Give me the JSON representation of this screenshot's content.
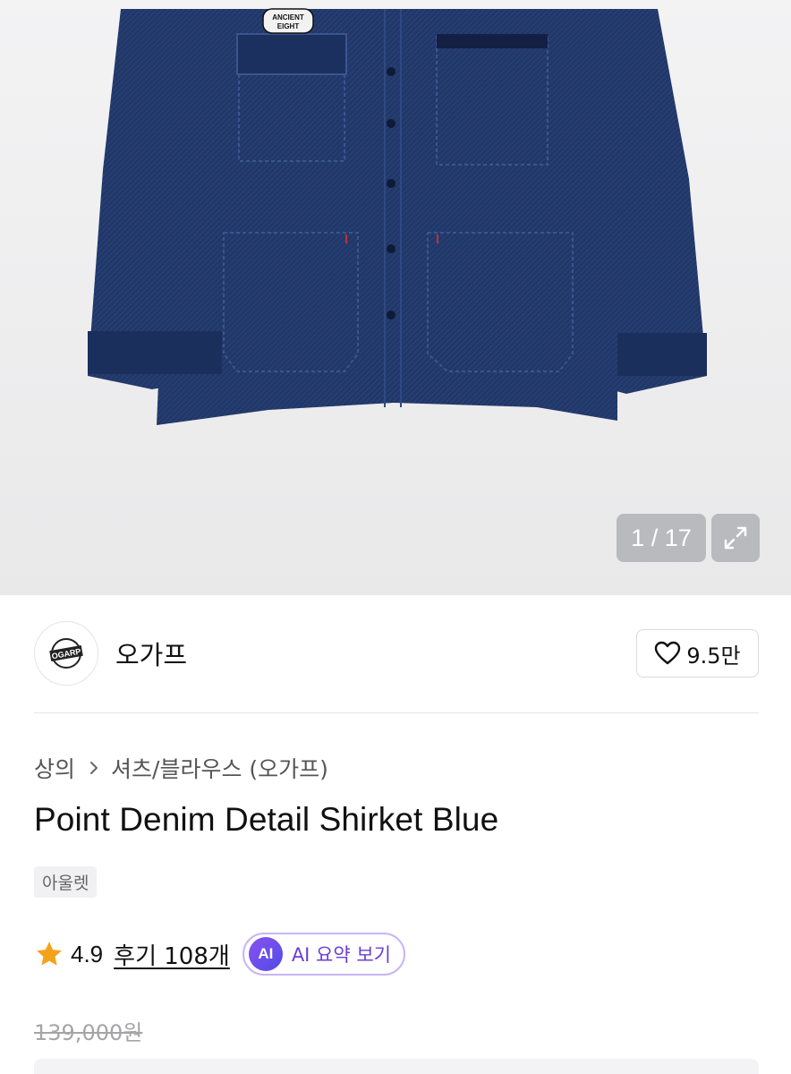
{
  "gallery": {
    "counter": "1 / 17",
    "patch_text_line1": "ANCIENT",
    "patch_text_line2": "EIGHT"
  },
  "brand": {
    "name": "오가프",
    "logo_text": "OGARP",
    "likes": "9.5만"
  },
  "breadcrumb": {
    "category": "상의",
    "subcategory": "셔츠/블라우스 (오가프)"
  },
  "product": {
    "title": "Point Denim Detail Shirket Blue",
    "tag": "아울렛",
    "rating": "4.9",
    "reviews": "후기 108개",
    "ai_badge": "AI",
    "ai_summary": "AI 요약 보기",
    "original_price": "139,000원"
  },
  "colors": {
    "denim": "#1f3466",
    "star": "#f5a21b",
    "ai_accent": "#6a3fd1"
  },
  "icons": [
    "expand-icon",
    "heart-icon",
    "chevron-right-icon",
    "star-icon"
  ]
}
